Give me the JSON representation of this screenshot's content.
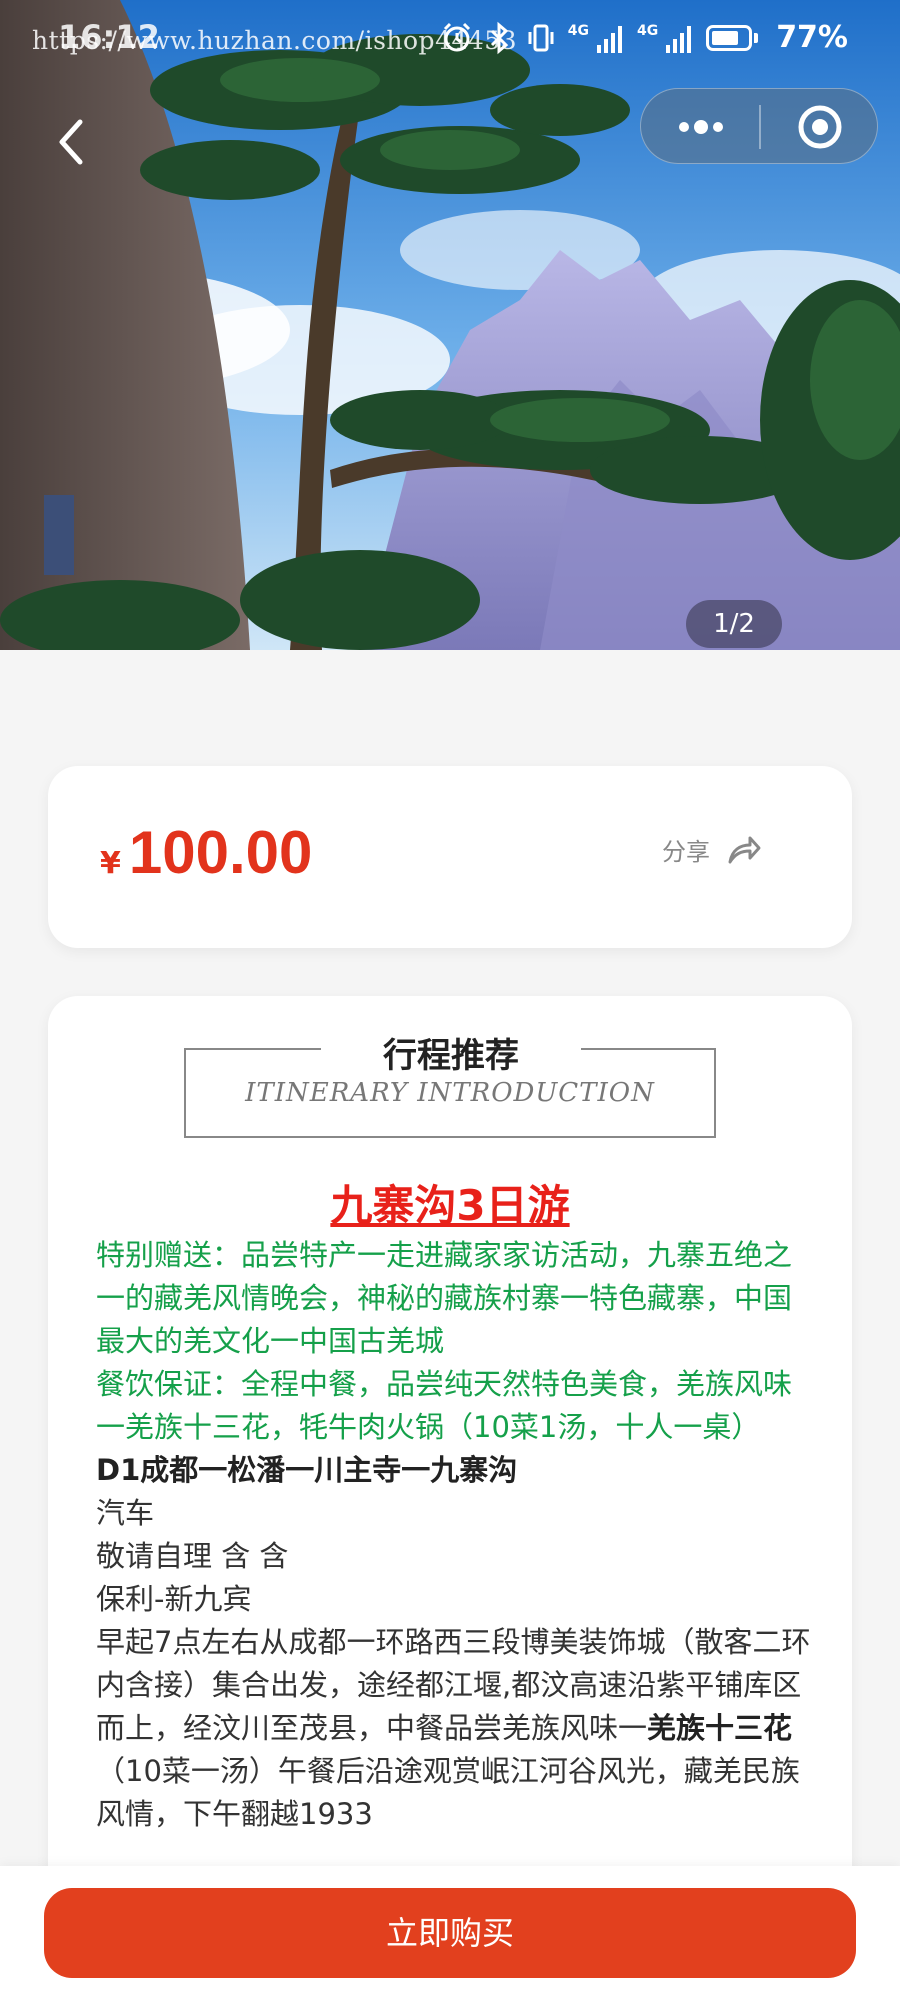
{
  "status_bar": {
    "time": "16:12",
    "watermark": "https://www.huzhan.com/ishop44453",
    "network_label": "4G",
    "network_label_2": "4G",
    "battery_percent": "77%",
    "battery_level": 0.77,
    "icons": [
      "alarm-icon",
      "bluetooth-icon",
      "vibrate-icon",
      "signal-icon",
      "signal-icon"
    ]
  },
  "nav": {
    "back_icon": "chevron-left-icon",
    "more_icon": "more-dots-icon",
    "close_icon": "target-circle-icon"
  },
  "gallery": {
    "counter": "1/2",
    "current": 1,
    "total": 2
  },
  "product": {
    "currency": "¥",
    "price": "100.00",
    "share_label": "分享",
    "share_icon": "share-arrow-icon"
  },
  "itinerary": {
    "title": "行程推荐",
    "subtitle": "ITINERARY INTRODUCTION",
    "trip_title": "九寨沟3日游",
    "gift_text": "特别赠送：品尝特产一走进藏家家访活动，九寨五绝之一的藏羌风情晚会，神秘的藏族村寨一特色藏寨，中国最大的羌文化一中国古羌城",
    "meal_text": "餐饮保证：全程中餐，品尝纯天然特色美食，羌族风味一羌族十三花，牦牛肉火锅（10菜1汤，十人一桌）",
    "day1_title": "D1成都一松潘一川主寺一九寨沟",
    "day1_transport": "汽车",
    "day1_meals": "敬请自理 含 含",
    "day1_hotel": "保利-新九宾",
    "day1_desc_part1": "早起7点左右从成都一环路西三段博美装饰城（散客二环内含接）集合出发，途经都江堰,都汶高速沿紫平铺库区而上，经汶川至茂县，中餐品尝羌族风味一",
    "day1_desc_bold": "羌族十三花",
    "day1_desc_part2": "（10菜一汤）午餐后沿途观赏岷江河谷风光，藏羌民族风情，下午翻越1933"
  },
  "actions": {
    "buy_label": "立即购买"
  },
  "colors": {
    "accent_red": "#e2331c",
    "button_red": "#e2401e",
    "trip_title_red": "#e8211a",
    "highlight_green": "#15a04a"
  }
}
